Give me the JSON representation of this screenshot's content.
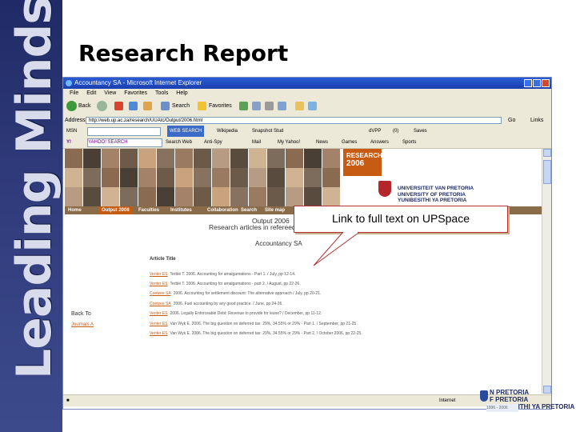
{
  "sidebar": {
    "text": "Leading Minds"
  },
  "slide": {
    "title": "Research Report"
  },
  "browser": {
    "title": "Accountancy SA - Microsoft Internet Explorer",
    "menu": [
      "File",
      "Edit",
      "View",
      "Favorites",
      "Tools",
      "Help"
    ],
    "toolbar": {
      "back": "Back",
      "search": "Search",
      "favorites": "Favorites"
    },
    "address_label": "Address",
    "address_value": "http://web.up.ac.za/research/UUAtc/Output/2006.html",
    "go": "Go",
    "links": "Links",
    "links_bar": [
      "WEB SEARCH",
      "Wikipedia",
      "Snapshot Stud",
      "dVPP",
      "(0)",
      "Saves"
    ],
    "yahoo_bar": [
      "Y!",
      "YAHOO! SEARCH",
      "Search Web",
      "Anti-Spy",
      "Mail",
      "My Yahoo!",
      "News",
      "Games",
      "Answers",
      "Sports"
    ],
    "status_zone": "Internet"
  },
  "site": {
    "banner_title": "RESEARCH",
    "banner_year": "2006",
    "university": [
      "UNIVERSITEIT VAN PRETORIA",
      "UNIVERSITY OF PRETORIA",
      "YUNIBESITHI YA PRETORIA"
    ],
    "nav": [
      "Home",
      "Output 2006",
      "Faculties",
      "Institutes",
      "Collaboration",
      "Search",
      "Site map"
    ],
    "heading_line1": "Output 2006",
    "heading_line2": "Research articles in refereed",
    "journal": "Accountancy SA",
    "article_header": "Article Title",
    "articles": [
      {
        "author": "Venter ES",
        "text": "Terblé T. 2006. Accounting for amalgamations - Part 1. / July, pp 12-14."
      },
      {
        "author": "Venter ES",
        "text": "Terblé T. 2006. Accounting for amalgamations - part 2. / August, pp 22-26."
      },
      {
        "author": "Coetzee SA",
        "text": "2006. Accounting for settlement discount: The alternative approach / July, pp 20-21."
      },
      {
        "author": "Coetzee SA",
        "text": "2006. Fuel accounting by any good practice. / June, pp 24-26."
      },
      {
        "author": "Venter ES",
        "text": "2006. Legally Enforceable Debt: Revenue to provide for leave? / December, pp 11-12."
      },
      {
        "author": "Venter ES",
        "text": "Van Wyk E. 2006. The big question on deferred tax: 29%, 34.55% or 29% - Part 1. / September, pp 21-25."
      },
      {
        "author": "Venter ES",
        "text": "Van Wyk E. 2006. The big question on deferred tax: 29%, 34.55% or 29% - Part 2. / October 2006, pp 22-25."
      }
    ],
    "back_to": "Back To",
    "back_link": "Journals A"
  },
  "callout": {
    "text": "Link to full text on UPSpace"
  },
  "corner": {
    "lines": [
      "N PRETORIA",
      "F PRETORIA",
      "YUNIBESITHI YA PRETORIA"
    ],
    "date": "1996 - 2006"
  }
}
